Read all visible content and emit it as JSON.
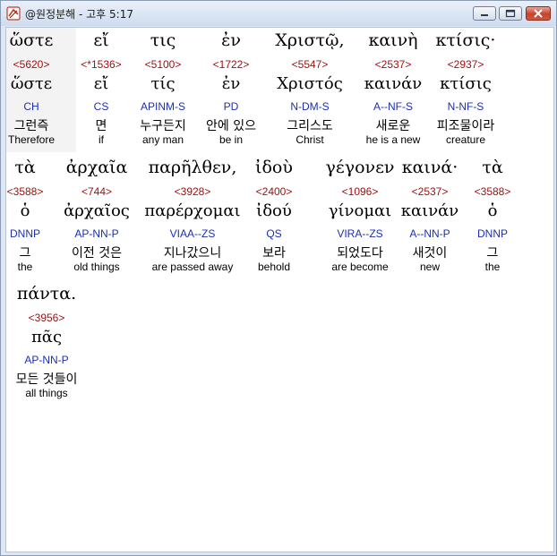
{
  "window": {
    "title": "@원정분해 - 고후 5:17",
    "minimize_icon": "minimize-icon",
    "maximize_icon": "maximize-icon",
    "close_icon": "close-icon"
  },
  "colors": {
    "strong": "#a01010",
    "parse": "#1c2fb0",
    "highlight": "#f3f3f3"
  },
  "rows": [
    {
      "words": [
        {
          "greek": "ὥστε",
          "strong": "<5620>",
          "lemma": "ὥστε",
          "parse": "CH",
          "korean": "그런즉",
          "english": "Therefore"
        },
        {
          "greek": "εἴ",
          "strong": "<*1536>",
          "lemma": "εἴ",
          "parse": "CS",
          "korean": "면",
          "english": "if"
        },
        {
          "greek": "τις",
          "strong": "<5100>",
          "lemma": "τίς",
          "parse": "APINM-S",
          "korean": "누구든지",
          "english": "any man"
        },
        {
          "greek": "ἐν",
          "strong": "<1722>",
          "lemma": "ἐν",
          "parse": "PD",
          "korean": "안에 있으",
          "english": "be in"
        },
        {
          "greek": "Χριστῷ,",
          "strong": "<5547>",
          "lemma": "Χριστός",
          "parse": "N-DM-S",
          "korean": "그리스도",
          "english": "Christ"
        },
        {
          "greek": "καινὴ",
          "strong": "<2537>",
          "lemma": "καινάν",
          "parse": "A--NF-S",
          "korean": "새로운",
          "english": "he is a new"
        },
        {
          "greek": "κτίσις·",
          "strong": "<2937>",
          "lemma": "κτίσις",
          "parse": "N-NF-S",
          "korean": "피조물이라",
          "english": "creature"
        }
      ]
    },
    {
      "words": [
        {
          "greek": "τὰ",
          "strong": "<3588>",
          "lemma": "ὁ",
          "parse": "DNNP",
          "korean": "그",
          "english": "the"
        },
        {
          "greek": "ἀρχαῖα",
          "strong": "<744>",
          "lemma": "ἀρχαῖος",
          "parse": "AP-NN-P",
          "korean": "이전 것은",
          "english": "old things"
        },
        {
          "greek": "παρῆλθεν,",
          "strong": "<3928>",
          "lemma": "παρέρχομαι",
          "parse": "VIAA--ZS",
          "korean": "지나갔으니",
          "english": "are passed away"
        },
        {
          "greek": "ἰδοὺ",
          "strong": "<2400>",
          "lemma": "ἰδού",
          "parse": "QS",
          "korean": "보라",
          "english": "behold"
        },
        {
          "greek": "γέγονεν",
          "strong": "<1096>",
          "lemma": "γίνομαι",
          "parse": "VIRA--ZS",
          "korean": "되었도다",
          "english": "are become"
        },
        {
          "greek": "καινά·",
          "strong": "<2537>",
          "lemma": "καινάν",
          "parse": "A--NN-P",
          "korean": "새것이",
          "english": "new"
        },
        {
          "greek": "τὰ",
          "strong": "<3588>",
          "lemma": "ὁ",
          "parse": "DNNP",
          "korean": "그",
          "english": "the"
        }
      ]
    },
    {
      "words": [
        {
          "greek": "πάντα.",
          "strong": "<3956>",
          "lemma": "πᾶς",
          "parse": "AP-NN-P",
          "korean": "모든 것들이",
          "english": "all things"
        }
      ]
    }
  ]
}
